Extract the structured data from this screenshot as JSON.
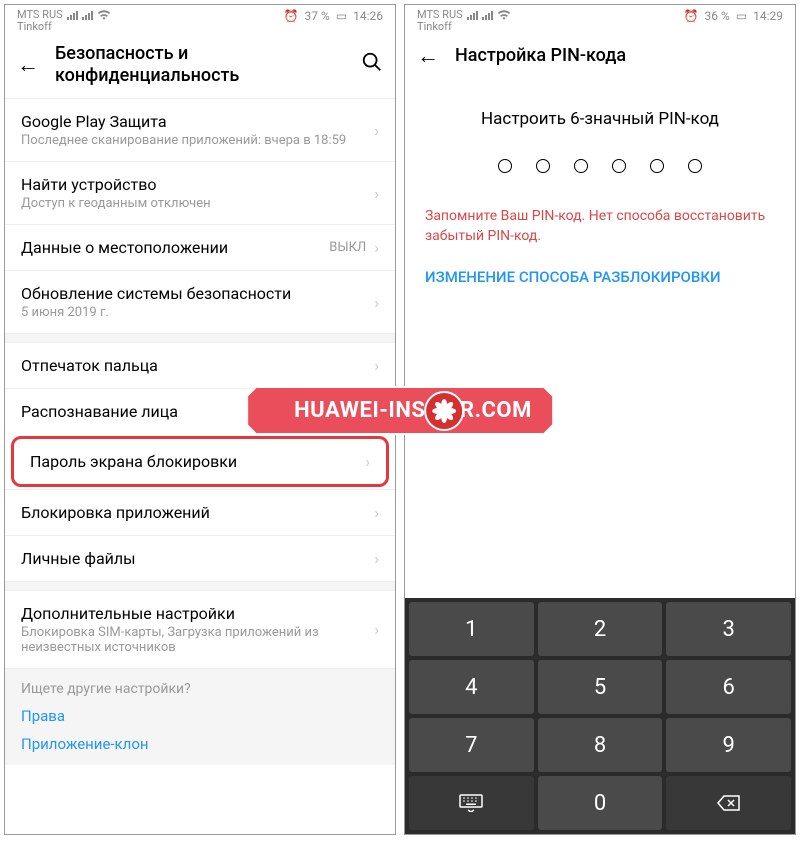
{
  "left": {
    "statusbar": {
      "carrier1": "MTS RUS",
      "carrier2": "Tinkoff",
      "battery": "37 %",
      "time": "14:26"
    },
    "header": "Безопасность и конфиденциальность",
    "items": [
      {
        "title": "Google Play Защита",
        "sub": "Последнее сканирование приложений: вчера в 18:59"
      },
      {
        "title": "Найти устройство",
        "sub": "Доступ к геоданным отключен"
      },
      {
        "title": "Данные о местоположении",
        "status": "ВЫКЛ"
      },
      {
        "title": "Обновление системы безопасности",
        "sub": "5 июня 2019 г."
      },
      {
        "title": "Отпечаток пальца"
      },
      {
        "title": "Распознавание лица"
      },
      {
        "title": "Пароль экрана блокировки"
      },
      {
        "title": "Блокировка приложений"
      },
      {
        "title": "Личные файлы"
      },
      {
        "title": "Дополнительные настройки",
        "sub": "Блокировка SIM-карты, Загрузка приложений из неизвестных источников"
      }
    ],
    "footer": {
      "prompt": "Ищете другие настройки?",
      "link1": "Права",
      "link2": "Приложение-клон"
    }
  },
  "right": {
    "statusbar": {
      "carrier1": "MTS RUS",
      "carrier2": "Tinkoff",
      "battery": "36 %",
      "time": "14:29"
    },
    "header": "Настройка PIN-кода",
    "prompt": "Настроить 6-значный PIN-код",
    "warning": "Запомните Ваш PIN-код. Нет способа восстановить забытый PIN-код.",
    "change": "ИЗМЕНЕНИЕ СПОСОБА РАЗБЛОКИРОВКИ",
    "keys": [
      "1",
      "2",
      "3",
      "4",
      "5",
      "6",
      "7",
      "8",
      "9",
      "0"
    ]
  },
  "watermark": "HUAWEI-INSIDER.COM"
}
